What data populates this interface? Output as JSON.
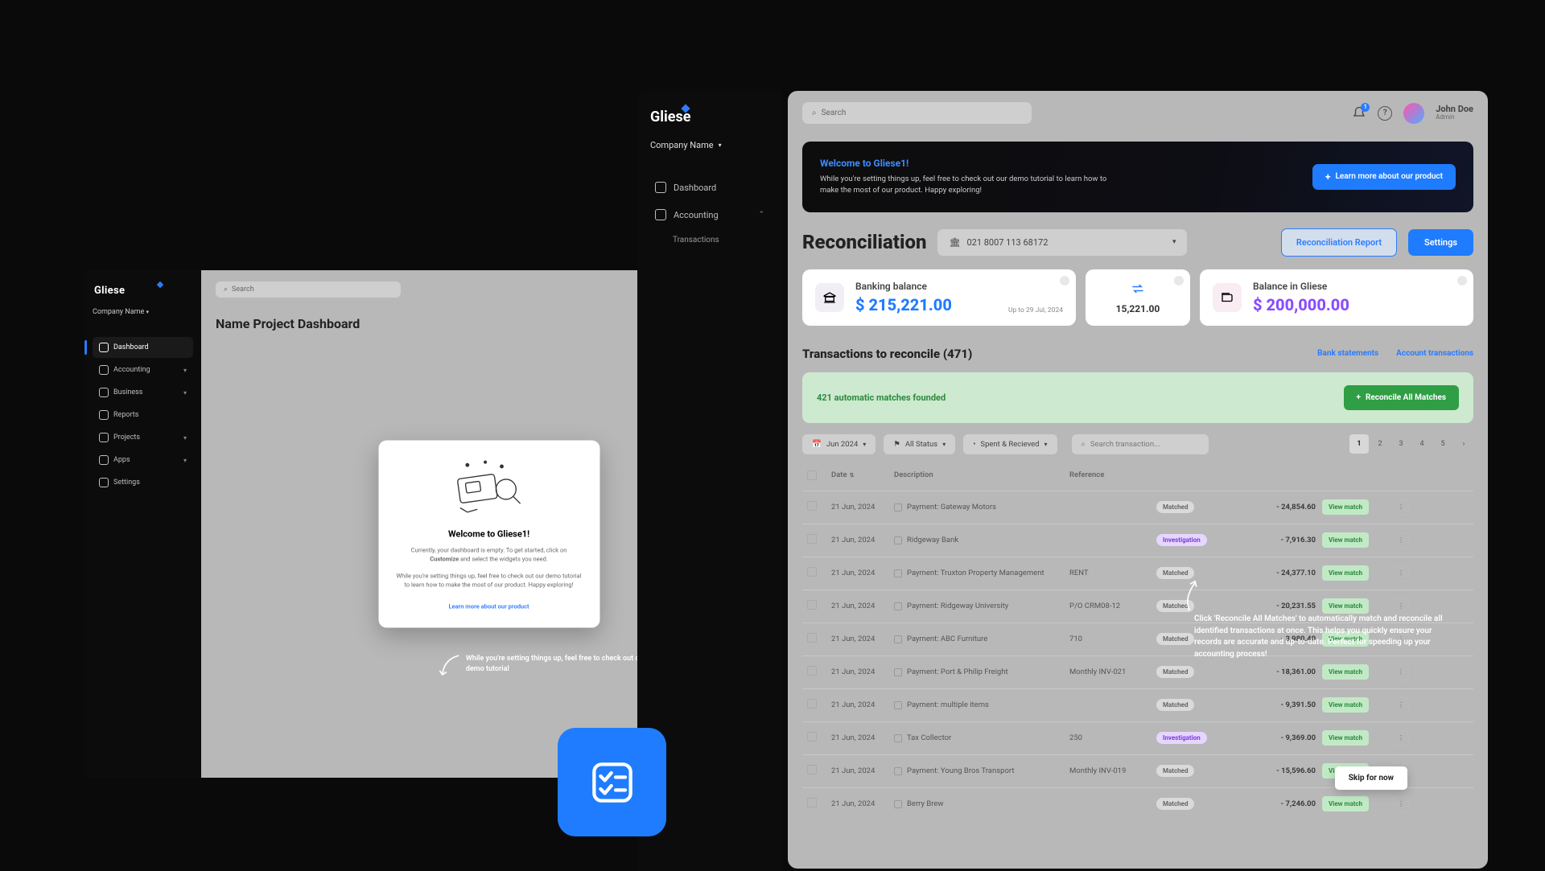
{
  "brand": "Gliese",
  "left": {
    "company": "Company Name",
    "nav": [
      "Dashboard",
      "Accounting",
      "Business",
      "Reports",
      "Projects",
      "Apps",
      "Settings"
    ],
    "search_placeholder": "Search",
    "user_name": "John Doe",
    "user_role": "Admin",
    "title": "Name Project Dashboard",
    "customize": "Customize",
    "modal_title": "Welcome to Gliese1!",
    "modal_p1a": "Currently, your dashboard is empty. To get started, click on ",
    "modal_p1b": "Customize",
    "modal_p1c": " and select the widgets you need.",
    "modal_p2": "While you're setting things up, feel free to check out our demo tutorial to learn how to make the most of our product. Happy exploring!",
    "modal_link": "Learn more about our product",
    "tip": "While you're setting things up, feel free to check out our demo tutorial",
    "skip": "Skip for now"
  },
  "mid": {
    "company": "Company Name",
    "items": [
      "Dashboard",
      "Accounting"
    ],
    "sub": "Transactions"
  },
  "right": {
    "search_placeholder": "Search",
    "notif_count": "1",
    "user_name": "John Doe",
    "user_role": "Admin",
    "banner_title": "Welcome to Gliese1!",
    "banner_sub": "While you're setting things up, feel free to check out our demo tutorial to learn how to make the most of our product. Happy exploring!",
    "learn": "Learn more about our product",
    "h1": "Reconciliation",
    "account": "021 8007 113 68172",
    "btn_report": "Reconciliation Report",
    "btn_settings": "Settings",
    "card1_label": "Banking balance",
    "card1_val": "$ 215,221.00",
    "card1_sub": "Up to 29 Jul, 2024",
    "card_mid_val": "15,221.00",
    "card2_label": "Balance in Gliese",
    "card2_val": "$ 200,000.00",
    "tx_title": "Transactions to reconcile (471)",
    "link_bank": "Bank statements",
    "link_acct": "Account transactions",
    "match_text": "421 automatic matches founded",
    "match_btn": "Reconcile All Matches",
    "filters": {
      "date": "Jun 2024",
      "status": "All Status",
      "type": "Spent & Recieved"
    },
    "search2_placeholder": "Search transaction...",
    "pages": [
      "1",
      "2",
      "3",
      "4",
      "5"
    ],
    "cols": {
      "date": "Date",
      "desc": "Description",
      "ref": "Reference"
    },
    "view": "View match",
    "callout": "Click 'Reconcile All Matches' to automatically match and reconcile all identified transactions at once. This helps you quickly ensure your records are accurate and up-to-date. Perfect for speeding up your accounting process!",
    "skip": "Skip for now",
    "rows": [
      {
        "date": "21 Jun, 2024",
        "desc": "Payment: Gateway Motors",
        "ref": "",
        "status": "Matched",
        "amt": "-  24,854.60"
      },
      {
        "date": "21 Jun, 2024",
        "desc": "Ridgeway Bank",
        "ref": "",
        "status": "Investigation",
        "amt": "-  7,916.30"
      },
      {
        "date": "21 Jun, 2024",
        "desc": "Payment: Truxton Property Management",
        "ref": "RENT",
        "status": "Matched",
        "amt": "-  24,377.10"
      },
      {
        "date": "21 Jun, 2024",
        "desc": "Payment: Ridgeway University",
        "ref": "P/O CRM08-12",
        "status": "Matched",
        "amt": "-  20,231.55"
      },
      {
        "date": "21 Jun, 2024",
        "desc": "Payment: ABC Furniture",
        "ref": "710",
        "status": "Matched",
        "amt": "-  3,980.40"
      },
      {
        "date": "21 Jun, 2024",
        "desc": "Payment: Port & Philip Freight",
        "ref": "Monthly INV-021",
        "status": "Matched",
        "amt": "-  18,361.00"
      },
      {
        "date": "21 Jun, 2024",
        "desc": "Payment: multiple items",
        "ref": "",
        "status": "Matched",
        "amt": "-  9,391.50"
      },
      {
        "date": "21 Jun, 2024",
        "desc": "Tax Collector",
        "ref": "250",
        "status": "Investigation",
        "amt": "-  9,369.00"
      },
      {
        "date": "21 Jun, 2024",
        "desc": "Payment: Young Bros Transport",
        "ref": "Monthly INV-019",
        "status": "Matched",
        "amt": "-  15,596.60"
      },
      {
        "date": "21 Jun, 2024",
        "desc": "Berry Brew",
        "ref": "",
        "status": "Matched",
        "amt": "-  7,246.00"
      }
    ]
  }
}
